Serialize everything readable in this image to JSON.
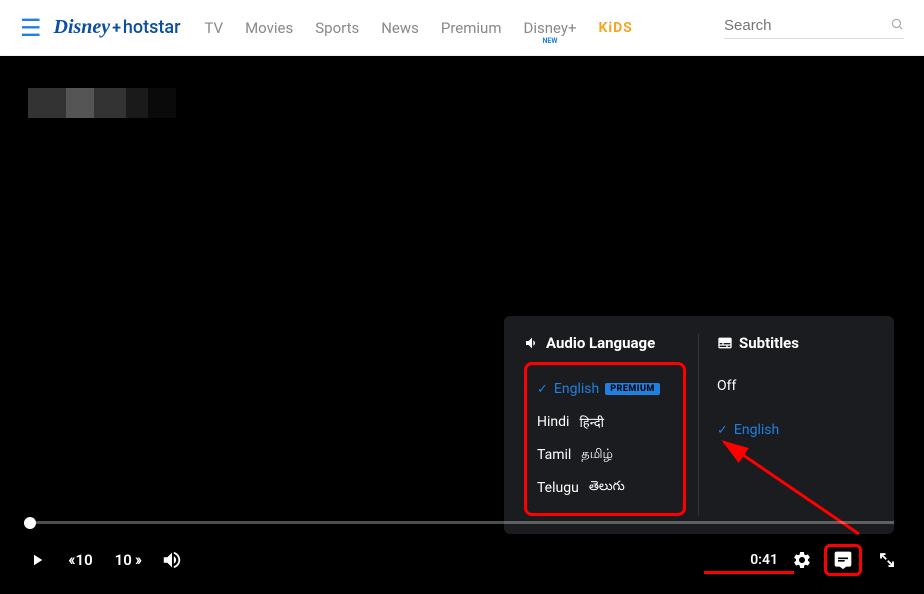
{
  "header": {
    "logo_brand": "Disney",
    "logo_plus": "+",
    "logo_sub": "hotstar",
    "nav": [
      "TV",
      "Movies",
      "Sports",
      "News",
      "Premium",
      "Disney+",
      "KiDS"
    ],
    "new_label": "NEW",
    "search_placeholder": "Search"
  },
  "player": {
    "rewind_seconds": "10",
    "forward_seconds": "10",
    "time": "0:41"
  },
  "popup": {
    "audio_title": "Audio Language",
    "subtitles_title": "Subtitles",
    "premium_label": "PREMIUM",
    "audio_options": [
      {
        "label": "English",
        "native": "",
        "selected": true,
        "premium": true
      },
      {
        "label": "Hindi",
        "native": "हिन्दी",
        "selected": false,
        "premium": false
      },
      {
        "label": "Tamil",
        "native": "தமிழ்",
        "selected": false,
        "premium": false
      },
      {
        "label": "Telugu",
        "native": "తెలుగు",
        "selected": false,
        "premium": false
      }
    ],
    "subtitle_options": [
      {
        "label": "Off",
        "selected": false
      },
      {
        "label": "English",
        "selected": true
      }
    ]
  }
}
